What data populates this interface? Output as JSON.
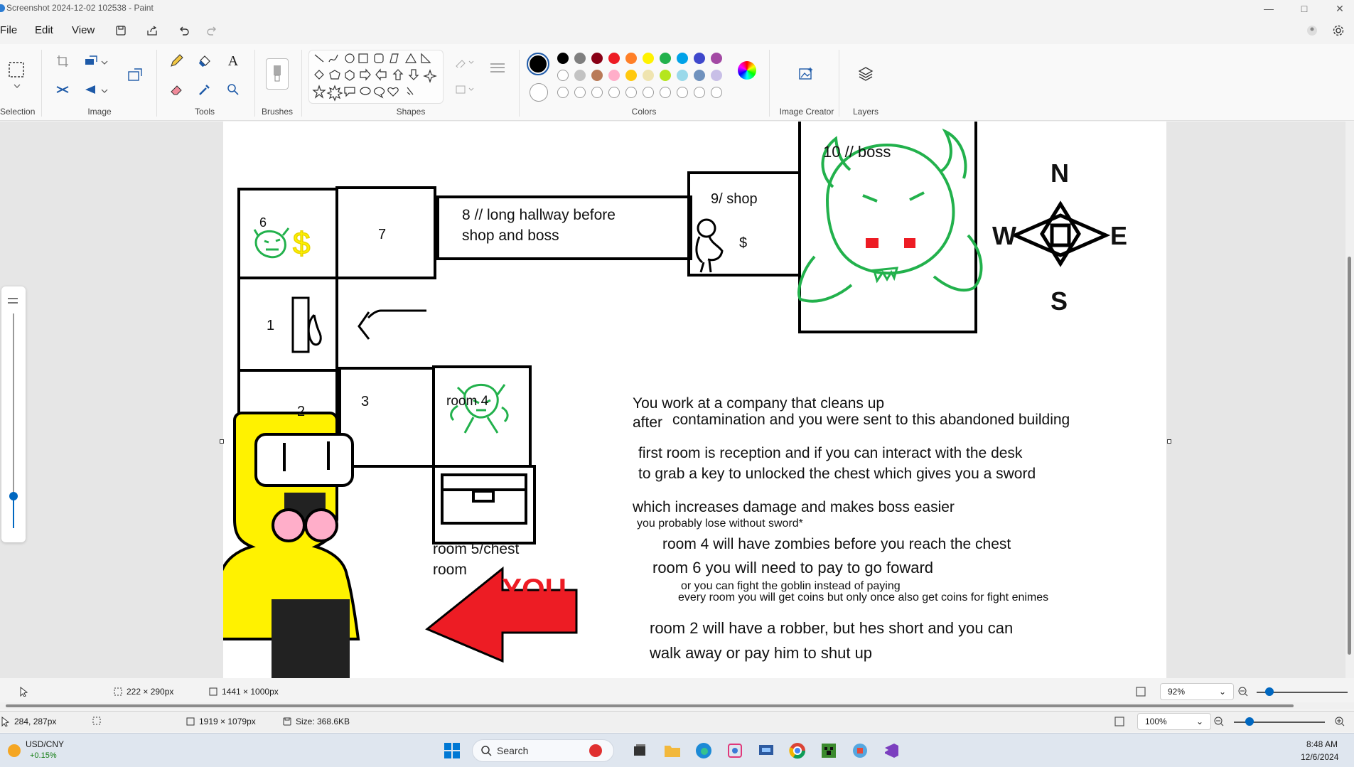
{
  "window": {
    "title": "Screenshot 2024-12-02 102538 - Paint",
    "minimize_icon": "minimize-icon",
    "maximize_icon": "maximize-icon",
    "close_icon": "close-icon"
  },
  "menu": {
    "file": "File",
    "edit": "Edit",
    "view": "View"
  },
  "ribbon": {
    "groups": {
      "selection": "Selection",
      "image": "Image",
      "tools": "Tools",
      "brushes": "Brushes",
      "shapes": "Shapes",
      "colors": "Colors",
      "image_creator": "Image Creator",
      "layers": "Layers"
    },
    "colors": {
      "primary": "#000000",
      "row1": [
        "#000000",
        "#7f7f7f",
        "#880015",
        "#ed1c24",
        "#ff7f27",
        "#fff200",
        "#22b14c",
        "#00a2e8",
        "#3f48cc",
        "#a349a4"
      ],
      "row2": [
        "#ffffff",
        "#c3c3c3",
        "#b97a57",
        "#ffaec9",
        "#ffc90e",
        "#efe4b0",
        "#b5e61d",
        "#99d9ea",
        "#7092be",
        "#c8bfe7"
      ]
    }
  },
  "canvas": {
    "rooms": {
      "r1": "1",
      "r2": "2",
      "r3": "3",
      "r4": "room 4",
      "r5_line1": "room 5/chest",
      "r5_line2": "room",
      "r6": "6",
      "r7": "7",
      "r8_line1": "8 // long hallway before",
      "r8_line2": "shop and boss",
      "r9": "9/ shop",
      "r9_price": "$",
      "r10": "10 // boss"
    },
    "compass": {
      "n": "N",
      "s": "S",
      "w": "W",
      "e": "E"
    },
    "you_label": "YOU",
    "story": {
      "l1": "You work at a company that cleans up",
      "l2a": "after",
      "l2b": "contamination and you were sent to this abandoned building",
      "l3": "first room is reception and if you can interact with the desk",
      "l4": "to grab a key to unlocked the chest which gives you a sword",
      "l5": "which increases damage and makes boss easier",
      "l6": "you probably lose without sword*",
      "l7": "room 4 will have zombies before you reach the chest",
      "l8": "room 6 you will need to pay to go foward",
      "l9": "or you can fight the goblin instead of paying",
      "l10": "every room you will get coins but only once also get coins for fight enimes",
      "l11": "room 2 will have a robber, but hes short and you can",
      "l12": "walk away or pay him to shut up"
    }
  },
  "status_inner": {
    "selection_size": "222 × 290px",
    "canvas_size": "1441 × 1000px",
    "zoom": "92%"
  },
  "status_outer": {
    "cursor_pos": "284, 287px",
    "canvas_size": "1919 × 1079px",
    "file_size": "Size: 368.6KB",
    "zoom": "100%"
  },
  "taskbar": {
    "widget_title": "USD/CNY",
    "widget_value": "+0.15%",
    "search_placeholder": "Search",
    "time": "8:48 AM",
    "date": "12/6/2024"
  }
}
